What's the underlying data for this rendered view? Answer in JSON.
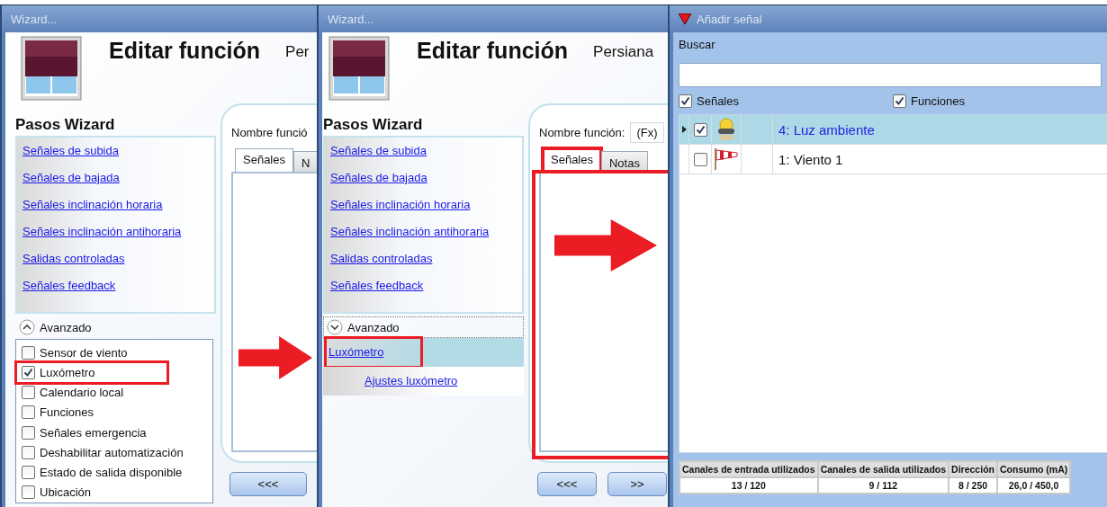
{
  "panels": [
    {
      "kind": "wizard",
      "title": "Wizard...",
      "heading": "Editar función",
      "subtitle": "Per",
      "steps_heading": "Pasos Wizard",
      "steps": [
        "Señales de subida",
        "Señales de bajada",
        "Señales inclinación horaria",
        "Señales inclinación antihoraria",
        "Salidas controladas",
        "Señales feedback"
      ],
      "advanced": {
        "label": "Avanzado",
        "expanded": true
      },
      "options": [
        {
          "label": "Sensor de viento",
          "checked": false
        },
        {
          "label": "Luxómetro",
          "checked": true
        },
        {
          "label": "Calendario local",
          "checked": false
        },
        {
          "label": "Funciones",
          "checked": false
        },
        {
          "label": "Señales emergencia",
          "checked": false
        },
        {
          "label": "Deshabilitar automatización",
          "checked": false
        },
        {
          "label": "Estado de salida disponible",
          "checked": false
        },
        {
          "label": "Ubicación",
          "checked": false
        }
      ],
      "field_label": "Nombre funció",
      "tabs": [
        {
          "label": "Señales",
          "selected": true
        },
        {
          "label": "N",
          "selected": false
        }
      ],
      "buttons": [
        "<<<"
      ]
    },
    {
      "kind": "wizard",
      "title": "Wizard...",
      "heading": "Editar función",
      "subtitle": "Persiana",
      "steps_heading": "Pasos Wizard",
      "steps": [
        "Señales de subida",
        "Señales de bajada",
        "Señales inclinación horaria",
        "Señales inclinación antihoraria",
        "Salidas controladas",
        "Señales feedback"
      ],
      "advanced": {
        "label": "Avanzado",
        "expanded": false
      },
      "extra_steps": [
        {
          "label": "Luxómetro",
          "selected": true,
          "children": [
            {
              "label": "Ajustes luxómetro",
              "selected": false
            }
          ]
        }
      ],
      "field_label": "Nombre función:",
      "field_value": "(Fx)",
      "tabs": [
        {
          "label": "Señales",
          "selected": true
        },
        {
          "label": "Notas",
          "selected": false
        }
      ],
      "buttons": [
        "<<<",
        ">>"
      ]
    },
    {
      "kind": "signals",
      "title": "Añadir señal",
      "search_label": "Buscar",
      "filters": [
        {
          "label": "Señales",
          "checked": true
        },
        {
          "label": "Funciones",
          "checked": true
        }
      ],
      "rows": [
        {
          "kind": "light",
          "label": "4: Luz ambiente",
          "checked": true,
          "selected": true
        },
        {
          "kind": "wind",
          "label": "1: Viento 1",
          "checked": false,
          "selected": false
        }
      ],
      "stats": {
        "columns": [
          "Canales de entrada utilizados",
          "Canales de salida utilizados",
          "Dirección",
          "Consumo (mA)"
        ],
        "values": [
          "13 / 120",
          "9 / 112",
          "8 / 250",
          "26,0 / 450,0"
        ]
      }
    }
  ]
}
